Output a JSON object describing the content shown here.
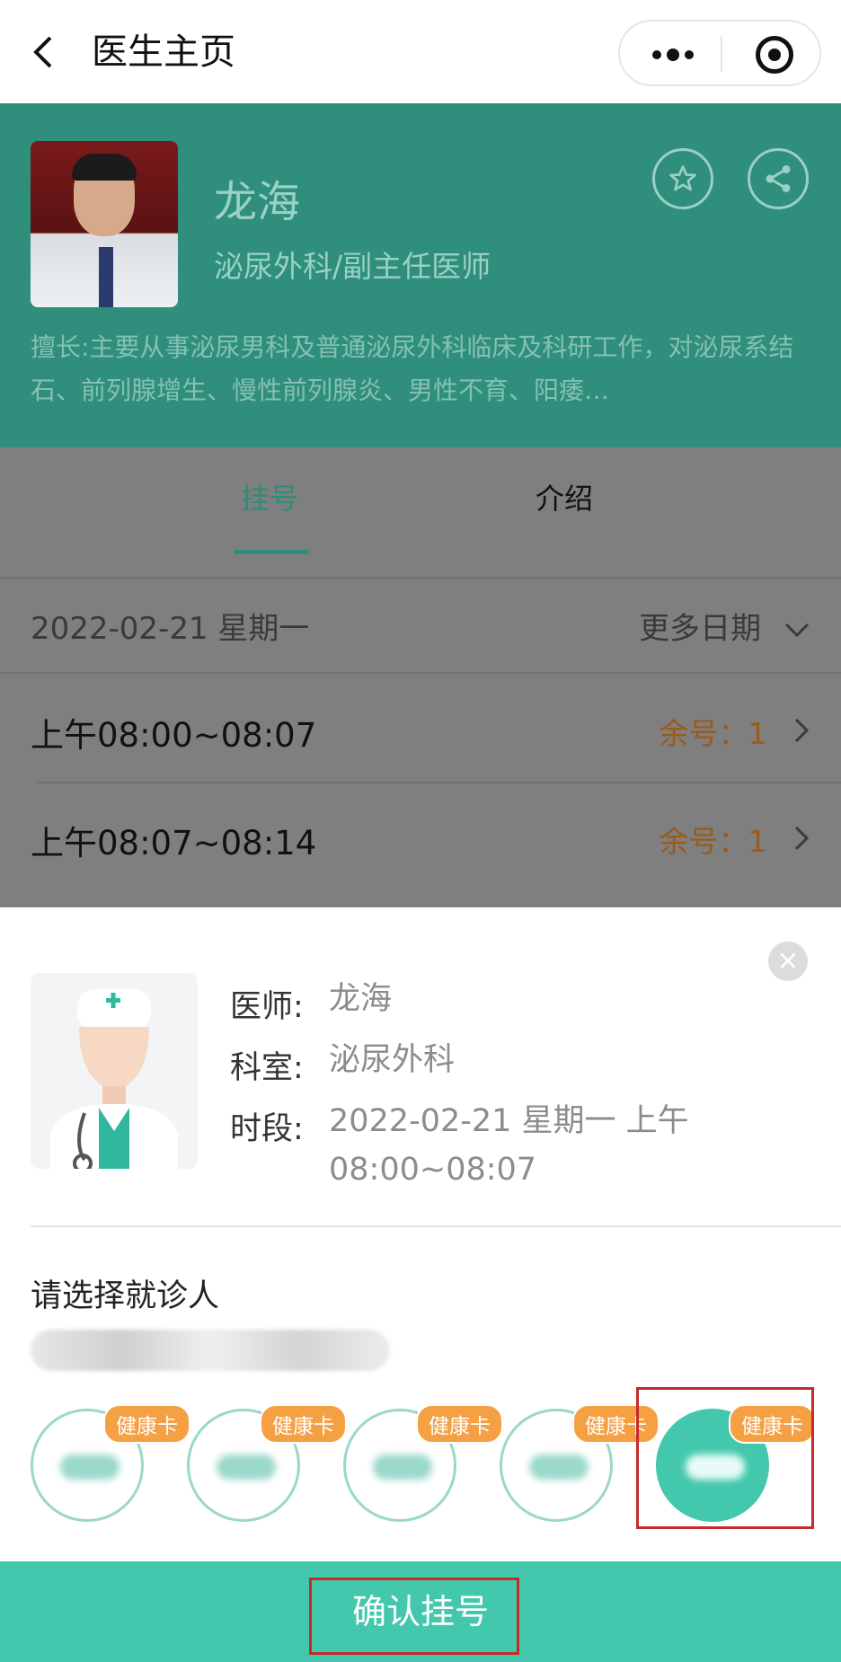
{
  "nav": {
    "title": "医生主页"
  },
  "doctor": {
    "name": "龙海",
    "title": "泌尿外科/副主任医师",
    "desc": "擅长:主要从事泌尿男科及普通泌尿外科临床及科研工作，对泌尿系结石、前列腺增生、慢性前列腺炎、男性不育、阳痿…"
  },
  "tabs": {
    "register": "挂号",
    "intro": "介绍"
  },
  "schedule": {
    "date": "2022-02-21 星期一",
    "more": "更多日期",
    "slots": [
      {
        "time": "上午08:00~08:07",
        "remain": "余号：1"
      },
      {
        "time": "上午08:07~08:14",
        "remain": "余号：1"
      }
    ]
  },
  "sheet": {
    "doctor_label": "医师:",
    "doctor_value": "龙海",
    "dept_label": "科室:",
    "dept_value": "泌尿外科",
    "time_label": "时段:",
    "time_value_line1": "2022-02-21 星期一 上午",
    "time_value_line2": "08:00~08:07",
    "choose_title": "请选择就诊人",
    "badge": "健康卡",
    "confirm": "确认挂号"
  },
  "colors": {
    "accent": "#44c8ad",
    "header_green": "#2f8f7c",
    "badge_orange": "#f5a043",
    "highlight_red": "#c42b2b"
  },
  "icons": [
    "back-icon",
    "more-icon",
    "target-icon",
    "star-icon",
    "share-icon",
    "close-icon",
    "chevron-down-icon",
    "chevron-right-icon"
  ]
}
